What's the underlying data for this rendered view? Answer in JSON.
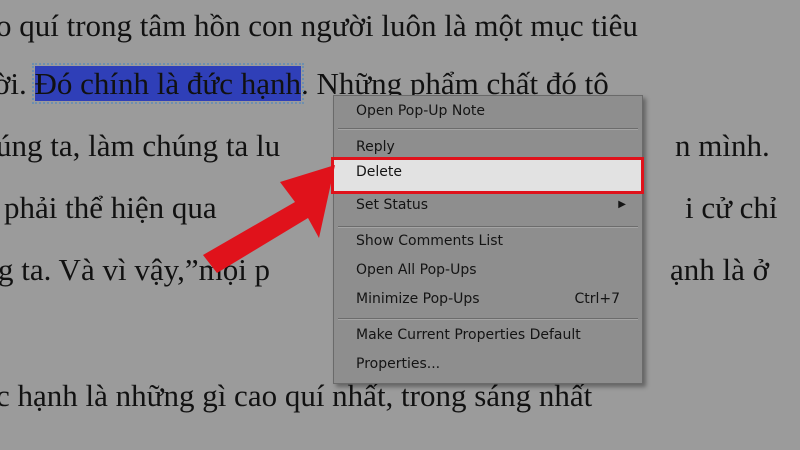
{
  "document": {
    "lines": [
      "o quí trong tâm hồn con người luôn là một mục tiêu",
      "ời. ",
      "Đó chính là đức hạnh",
      ". Những phẩm chất đó tô",
      "úng ta, làm chúng ta lu",
      "n mình.",
      "phải thể hiện qua",
      "i cử chỉ",
      "g ta. Và vì vậy,”mọi p",
      "ạnh là ở",
      "c hạnh là những gì cao quí nhất, trong sáng nhất"
    ]
  },
  "menu": {
    "items": [
      {
        "label": "Open Pop-Up Note"
      },
      {
        "label": "Reply"
      },
      {
        "label": "Delete"
      },
      {
        "label": "Set Status"
      },
      {
        "label": "Show Comments List"
      },
      {
        "label": "Open All Pop-Ups"
      },
      {
        "label": "Minimize Pop-Ups",
        "shortcut": "Ctrl+7"
      },
      {
        "label": "Make Current Properties Default"
      },
      {
        "label": "Properties..."
      }
    ]
  },
  "colors": {
    "highlight": "#e0121b",
    "selection": "#2f3fb8"
  }
}
